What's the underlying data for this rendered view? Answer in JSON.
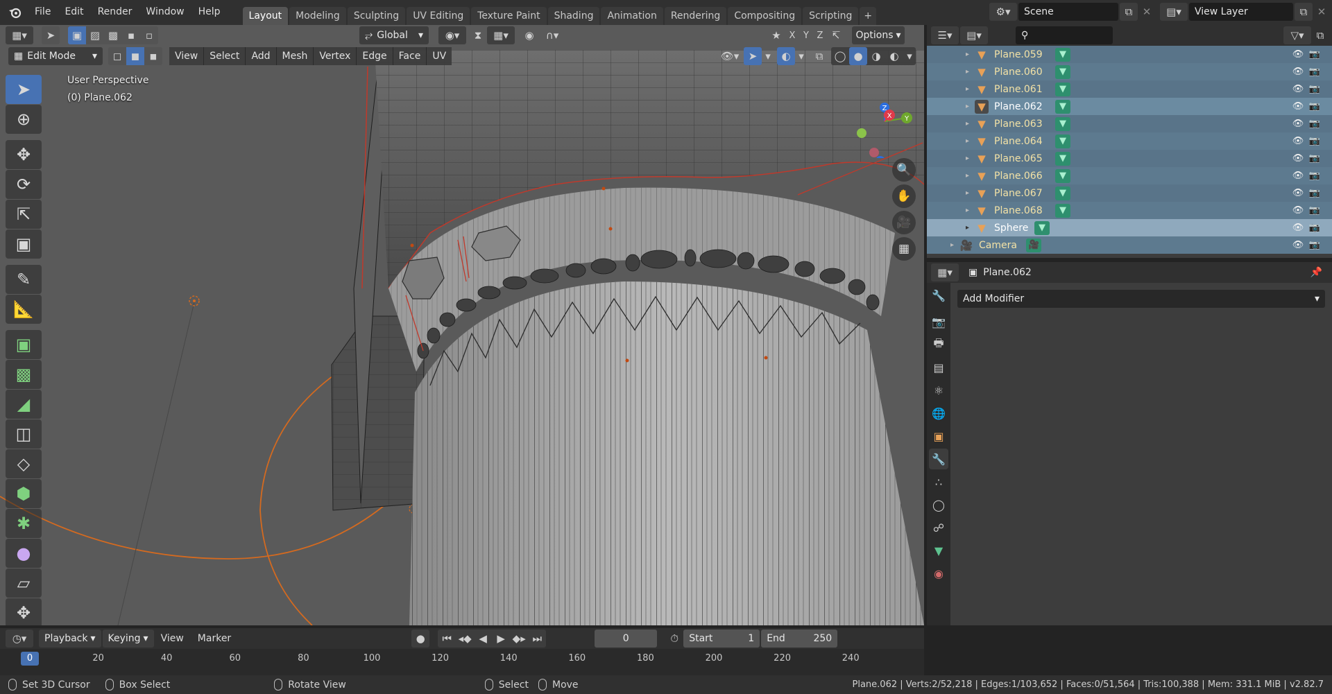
{
  "topbar": {
    "menus": [
      "File",
      "Edit",
      "Render",
      "Window",
      "Help"
    ],
    "workspaces": [
      "Layout",
      "Modeling",
      "Sculpting",
      "UV Editing",
      "Texture Paint",
      "Shading",
      "Animation",
      "Rendering",
      "Compositing",
      "Scripting"
    ],
    "active_workspace": "Layout",
    "add_tab": "+",
    "scene_label": "Scene",
    "view_layer_label": "View Layer"
  },
  "viewport": {
    "transform_orientation": "Global",
    "axes": [
      "X",
      "Y",
      "Z"
    ],
    "options_label": "Options",
    "mode": "Edit Mode",
    "menus": [
      "View",
      "Select",
      "Add",
      "Mesh",
      "Vertex",
      "Edge",
      "Face",
      "UV"
    ],
    "perspective": "User Perspective",
    "object_info": "(0) Plane.062",
    "gizmo": {
      "x": "X",
      "y": "Y",
      "z": "Z"
    }
  },
  "outliner": {
    "items": [
      {
        "name": "Plane.059",
        "type": "mesh"
      },
      {
        "name": "Plane.060",
        "type": "mesh"
      },
      {
        "name": "Plane.061",
        "type": "mesh"
      },
      {
        "name": "Plane.062",
        "type": "mesh"
      },
      {
        "name": "Plane.063",
        "type": "mesh"
      },
      {
        "name": "Plane.064",
        "type": "mesh"
      },
      {
        "name": "Plane.065",
        "type": "mesh"
      },
      {
        "name": "Plane.066",
        "type": "mesh"
      },
      {
        "name": "Plane.067",
        "type": "mesh"
      },
      {
        "name": "Plane.068",
        "type": "mesh"
      },
      {
        "name": "Sphere",
        "type": "mesh"
      },
      {
        "name": "Camera",
        "type": "camera"
      }
    ]
  },
  "properties": {
    "object_name": "Plane.062",
    "add_modifier_label": "Add Modifier"
  },
  "timeline": {
    "menus": [
      "Playback",
      "Keying",
      "View",
      "Marker"
    ],
    "current_frame": "0",
    "start_label": "Start",
    "start_value": "1",
    "end_label": "End",
    "end_value": "250",
    "ticks": [
      "0",
      "20",
      "40",
      "60",
      "80",
      "100",
      "120",
      "140",
      "160",
      "180",
      "200",
      "220",
      "240"
    ]
  },
  "statusbar": {
    "hints": [
      "Set 3D Cursor",
      "Box Select",
      "Rotate View",
      "Select",
      "Move"
    ],
    "stats": "Plane.062 | Verts:2/52,218 | Edges:1/103,652 | Faces:0/51,564 | Tris:100,388 | Mem: 331.1 MiB | v2.82.7"
  },
  "colors": {
    "accent": "#4772b3",
    "object_orange": "#e8a157",
    "mesh_green": "#2e8f6e"
  }
}
